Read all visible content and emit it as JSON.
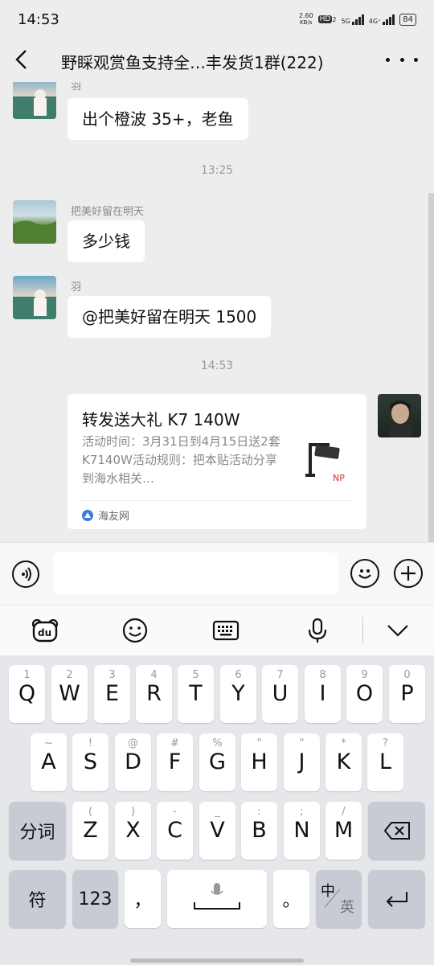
{
  "status": {
    "time": "14:53",
    "net_speed_top": "2.60",
    "net_speed_unit": "KB/s",
    "hd": "HD",
    "hd_sub": "2",
    "g5": "5G",
    "g4": "4G⁺",
    "battery": "84"
  },
  "header": {
    "title": "野睬观赏鱼支持全…丰发货1群(222)"
  },
  "messages": [
    {
      "name": "羽",
      "text": "出个橙波 35+，老鱼"
    },
    {
      "name": "把美好留在明天",
      "text": "多少钱"
    },
    {
      "name": "羽",
      "text": "@把美好留在明天 1500"
    }
  ],
  "timestamps": [
    "13:25",
    "14:53"
  ],
  "card": {
    "title": "转发送大礼 K7 140W",
    "desc": "活动时间：3月31日到4月15日送2套K7140W活动规则：把本贴活动分享到海水相关…",
    "source": "海友网"
  },
  "keyboard": {
    "row1": [
      [
        "Q",
        "1"
      ],
      [
        "W",
        "2"
      ],
      [
        "E",
        "3"
      ],
      [
        "R",
        "4"
      ],
      [
        "T",
        "5"
      ],
      [
        "Y",
        "6"
      ],
      [
        "U",
        "7"
      ],
      [
        "I",
        "8"
      ],
      [
        "O",
        "9"
      ],
      [
        "P",
        "0"
      ]
    ],
    "row2": [
      [
        "A",
        "~"
      ],
      [
        "S",
        "!"
      ],
      [
        "D",
        "@"
      ],
      [
        "F",
        "#"
      ],
      [
        "G",
        "%"
      ],
      [
        "H",
        "\""
      ],
      [
        "J",
        "\""
      ],
      [
        "K",
        "*"
      ],
      [
        "L",
        "?"
      ]
    ],
    "row3": [
      [
        "Z",
        "("
      ],
      [
        "X",
        ")"
      ],
      [
        "C",
        "-"
      ],
      [
        "V",
        "_"
      ],
      [
        "B",
        ":"
      ],
      [
        "N",
        ";"
      ],
      [
        "M",
        "/"
      ]
    ],
    "fenci": "分词",
    "fu": "符",
    "num": "123",
    "comma": "，",
    "period": "。",
    "zh": "中",
    "en": "英"
  },
  "colors": {
    "bubble": "#ffffff",
    "background": "#ededed",
    "keyboard": "#e6e7eb",
    "source_icon": "#3a7bd5"
  }
}
